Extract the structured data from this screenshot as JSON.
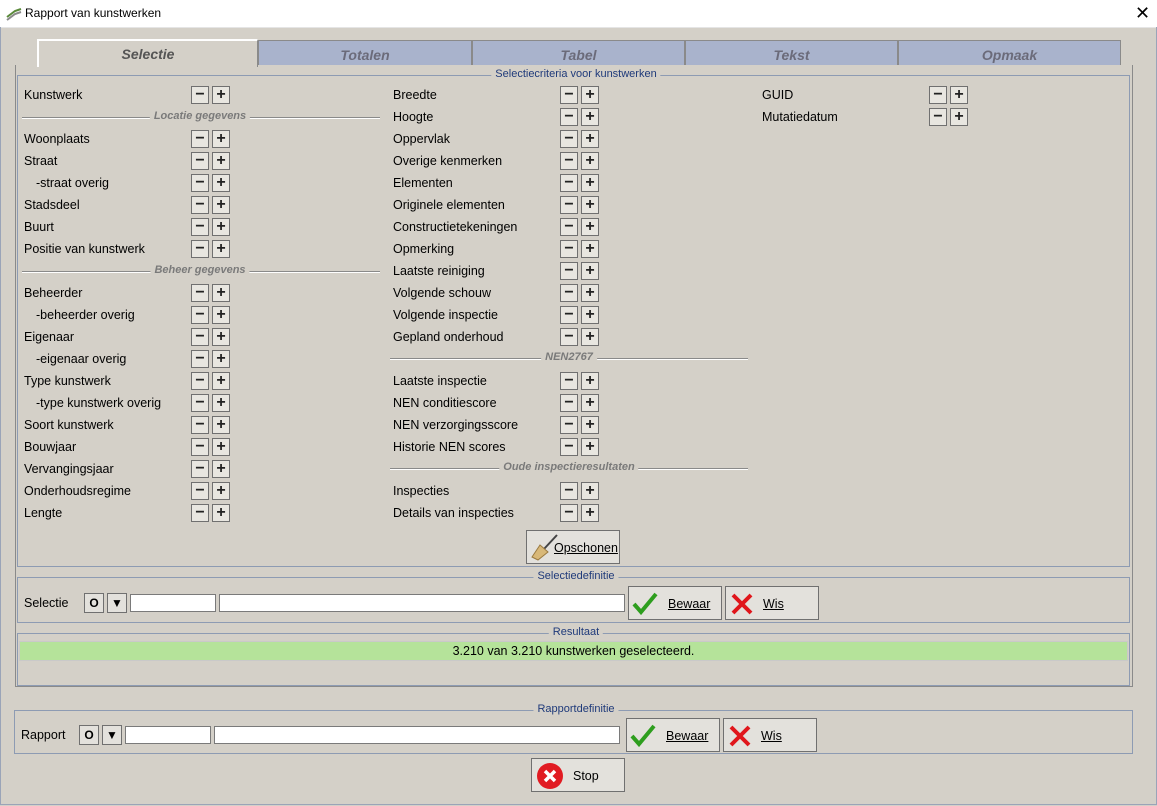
{
  "window": {
    "title": "Rapport van kunstwerken",
    "close_glyph": "✕"
  },
  "tabs": [
    {
      "label": "Selectie",
      "active": true
    },
    {
      "label": "Totalen",
      "active": false
    },
    {
      "label": "Tabel",
      "active": false
    },
    {
      "label": "Tekst",
      "active": false
    },
    {
      "label": "Opmaak",
      "active": false
    }
  ],
  "criteria": {
    "title": "Selectiecriteria voor kunstwerken",
    "col1": {
      "top_item": "Kunstwerk",
      "section_locatie": "Locatie gegevens",
      "locatie_items": [
        "Woonplaats",
        "Straat",
        "-straat overig",
        "Stadsdeel",
        "Buurt",
        "Positie van kunstwerk"
      ],
      "section_beheer": "Beheer gegevens",
      "beheer_items": [
        "Beheerder",
        "-beheerder overig",
        "Eigenaar",
        "-eigenaar overig",
        "Type kunstwerk",
        "-type kunstwerk overig",
        "Soort kunstwerk",
        "Bouwjaar",
        "Vervangingsjaar",
        "Onderhoudsregime",
        "Lengte"
      ]
    },
    "col2": {
      "items": [
        "Breedte",
        "Hoogte",
        "Oppervlak",
        "Overige kenmerken",
        "Elementen",
        "Originele elementen",
        "Constructietekeningen",
        "Opmerking",
        "Laatste reiniging",
        "Volgende schouw",
        "Volgende inspectie",
        "Gepland onderhoud"
      ],
      "section_nen": "NEN2767",
      "nen_items": [
        "Laatste inspectie",
        "NEN conditiescore",
        "NEN verzorgingsscore",
        "Historie NEN scores"
      ],
      "section_oude": "Oude inspectieresultaten",
      "oude_items": [
        "Inspecties",
        "Details van inspecties"
      ]
    },
    "col3": {
      "items": [
        "GUID",
        "Mutatiedatum"
      ]
    },
    "minus_glyph": "−",
    "plus_glyph": "+",
    "clear_button": "Opschonen"
  },
  "selectiedefinitie": {
    "title": "Selectiedefinitie",
    "label": "Selectie",
    "open_glyph": "O",
    "dropdown_glyph": "▼",
    "code_value": "",
    "name_value": "",
    "save_button": "Bewaar",
    "delete_button": "Wis"
  },
  "resultaat": {
    "title": "Resultaat",
    "text": "3.210 van 3.210 kunstwerken geselecteerd."
  },
  "rapportdefinitie": {
    "title": "Rapportdefinitie",
    "label": "Rapport",
    "open_glyph": "O",
    "dropdown_glyph": "▼",
    "code_value": "",
    "name_value": "",
    "save_button": "Bewaar",
    "delete_button": "Wis"
  },
  "stop_button": "Stop",
  "colors": {
    "result_bg": "#b5e39a",
    "tab_inactive": "#a9b3cc",
    "check_green": "#2e9e1e",
    "cross_red": "#e0161b",
    "stop_red": "#e11b22"
  }
}
